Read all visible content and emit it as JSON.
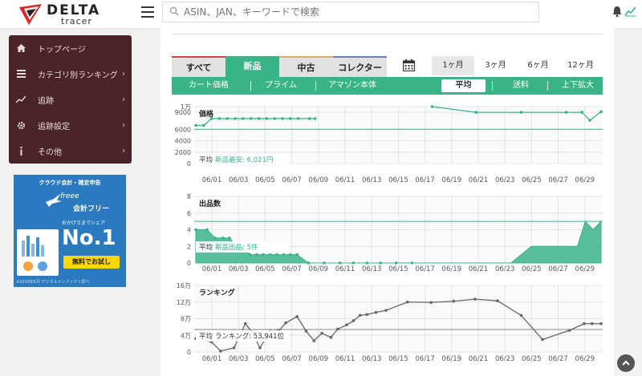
{
  "header": {
    "brand_name": "DELTA",
    "brand_sub": "tracer",
    "search_placeholder": "ASIN、JAN、キーワードで検索"
  },
  "sidebar": {
    "items": [
      {
        "label": "トップページ",
        "icon": "home-icon",
        "chevron": false
      },
      {
        "label": "カテゴリ別ランキング",
        "icon": "list-icon",
        "chevron": true
      },
      {
        "label": "追跡",
        "icon": "trend-icon",
        "chevron": true
      },
      {
        "label": "追跡設定",
        "icon": "gear-icon",
        "chevron": true
      },
      {
        "label": "その他",
        "icon": "info-icon",
        "chevron": true
      }
    ]
  },
  "ad": {
    "top": "クラウド会計・確定申告",
    "brand": "freee",
    "brand_jp": "会計フリー",
    "share": "おかげさまでシェア",
    "no1": "No.1",
    "cta": "無料でお試し",
    "note": "※2016年6月 デジタルインファクト調べ"
  },
  "tabs": [
    {
      "label": "すべて",
      "active": false
    },
    {
      "label": "新品",
      "active": true
    },
    {
      "label": "中古",
      "active": false
    },
    {
      "label": "コレクター",
      "active": false
    }
  ],
  "periods": [
    {
      "label": "1ヶ月",
      "active": true
    },
    {
      "label": "3ヶ月",
      "active": false
    },
    {
      "label": "6ヶ月",
      "active": false
    },
    {
      "label": "12ヶ月",
      "active": false
    }
  ],
  "subbar": {
    "left": [
      "カート価格",
      "プライム",
      "アマゾン本体"
    ],
    "right": [
      "平均",
      "送料",
      "上下拡大"
    ],
    "active": "平均"
  },
  "colors": {
    "accent": "#39b487",
    "sidebar": "#4a2427",
    "rank_line": "#666666"
  },
  "chart_data": [
    {
      "type": "line",
      "title": "価格",
      "ylim": [
        0,
        10000
      ],
      "yticks": [
        0,
        2000,
        4000,
        6000,
        9000,
        10000
      ],
      "ytick_labels": [
        "0",
        "2000",
        "4000",
        "6000",
        "9000",
        "1万"
      ],
      "x_labels": [
        "06/01",
        "06/03",
        "06/05",
        "06/07",
        "06/09",
        "06/11",
        "06/13",
        "06/15",
        "06/17",
        "06/19",
        "06/21",
        "06/23",
        "06/25",
        "06/27",
        "06/29"
      ],
      "series": [
        {
          "segment": 1,
          "x": [
            0,
            0.7,
            1.4,
            2.1,
            2.8,
            3.5,
            4.2,
            4.9,
            5.6,
            6.3,
            7.0,
            7.7,
            8.4,
            9.1,
            10.1,
            10.6
          ],
          "y": [
            6700,
            6700,
            7900,
            7900,
            7900,
            7900,
            7900,
            7900,
            7900,
            7900,
            7900,
            7900,
            7900,
            7900,
            7900,
            7900
          ]
        },
        {
          "segment": 2,
          "x": [
            21.0,
            24.9,
            28.9,
            32.9,
            34.3,
            35.0,
            36.0
          ],
          "y": [
            10000,
            9000,
            9000,
            9000,
            9000,
            7600,
            9100
          ]
        }
      ],
      "average_line": 6021,
      "average_label": "平均",
      "average_text": "新品最安: 6,021円"
    },
    {
      "type": "area",
      "title": "出品数",
      "ylim": [
        0,
        8
      ],
      "yticks": [
        0,
        2,
        4,
        6,
        8
      ],
      "ytick_labels": [
        "0",
        "2",
        "4",
        "6",
        "8"
      ],
      "x_labels": [
        "06/01",
        "06/03",
        "06/05",
        "06/07",
        "06/09",
        "06/11",
        "06/13",
        "06/15",
        "06/17",
        "06/19",
        "06/21",
        "06/23",
        "06/25",
        "06/27",
        "06/29"
      ],
      "x": [
        0,
        1.0,
        1.7,
        2.4,
        3.0,
        3.6,
        4.2,
        4.8,
        5.4,
        6.0,
        6.6,
        7.2,
        7.8,
        8.4,
        9.0,
        10.0,
        11.4,
        12.8,
        14.0,
        15.2,
        16.4,
        17.8,
        19.2,
        20.6,
        22.0,
        23.6,
        25.0,
        26.6,
        28.0,
        29.8,
        31.8,
        33.9,
        34.6,
        35.3,
        36.0
      ],
      "y": [
        4,
        4,
        3,
        3,
        3,
        2,
        2,
        1,
        1,
        1,
        1,
        1,
        1,
        1,
        1,
        0,
        0,
        0,
        0,
        0,
        0,
        0,
        0,
        0,
        0,
        0,
        0,
        0,
        0,
        2,
        2,
        2,
        5,
        4,
        5,
        4
      ],
      "reference_line": 5,
      "average_label": "平均",
      "average_text": "新品出品: 5件"
    },
    {
      "type": "line",
      "title": "ランキング",
      "ylim": [
        0,
        160000
      ],
      "yticks": [
        0,
        40000,
        80000,
        120000,
        160000
      ],
      "ytick_labels": [
        "0",
        "4万",
        "8万",
        "12万",
        "16万"
      ],
      "x_labels": [
        "06/01",
        "06/03",
        "06/05",
        "06/07",
        "06/09",
        "06/11",
        "06/13",
        "06/15",
        "06/17",
        "06/19",
        "06/21",
        "06/23",
        "06/25",
        "06/27",
        "06/29"
      ],
      "x": [
        0,
        1.4,
        2.2,
        3.4,
        4.4,
        5.0,
        5.7,
        6.6,
        7.4,
        8.0,
        9.0,
        9.8,
        10.5,
        11.2,
        12.0,
        12.6,
        13.4,
        14.0,
        14.6,
        15.2,
        16.0,
        16.9,
        18.8,
        20.9,
        22.9,
        24.8,
        26.8,
        28.9,
        30.8,
        33.2,
        34.5,
        35.2,
        36.0
      ],
      "y": [
        32000,
        24000,
        2000,
        10000,
        68000,
        48000,
        10000,
        50000,
        52000,
        70000,
        85000,
        50000,
        27000,
        45000,
        35000,
        55000,
        65000,
        75000,
        88000,
        90000,
        95000,
        100000,
        120000,
        119000,
        122000,
        127000,
        123000,
        88000,
        30000,
        52000,
        68000,
        68000,
        68000
      ],
      "average_line": 53941,
      "average_label": "平均",
      "average_text": "ランキング: 53,941位"
    }
  ]
}
